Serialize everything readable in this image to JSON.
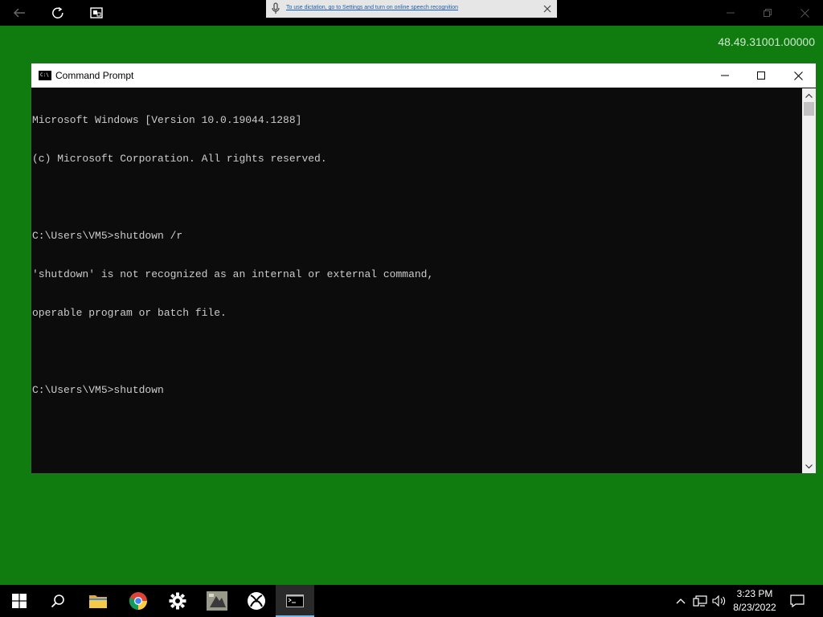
{
  "viewer": {
    "icons": [
      "back-arrow-icon",
      "refresh-icon",
      "screen-switch-icon"
    ],
    "dictation_notice": "To use dictation, go to Settings and turn on online speech recognition",
    "window_controls": [
      "minimize",
      "restore",
      "close"
    ]
  },
  "desktop": {
    "version": "48.49.31001.00000",
    "background": "#107c10"
  },
  "cmd_window": {
    "title": "Command Prompt",
    "lines": [
      "Microsoft Windows [Version 10.0.19044.1288]",
      "(c) Microsoft Corporation. All rights reserved.",
      "",
      "C:\\Users\\VM5>shutdown /r",
      "'shutdown' is not recognized as an internal or external command,",
      "operable program or batch file.",
      "",
      "C:\\Users\\VM5>shutdown"
    ]
  },
  "taskbar": {
    "items": [
      "start",
      "search",
      "file-explorer",
      "chrome",
      "settings",
      "app",
      "xbox",
      "command-prompt"
    ],
    "active_item": "command-prompt",
    "time": "3:23 PM",
    "date": "8/23/2022"
  }
}
